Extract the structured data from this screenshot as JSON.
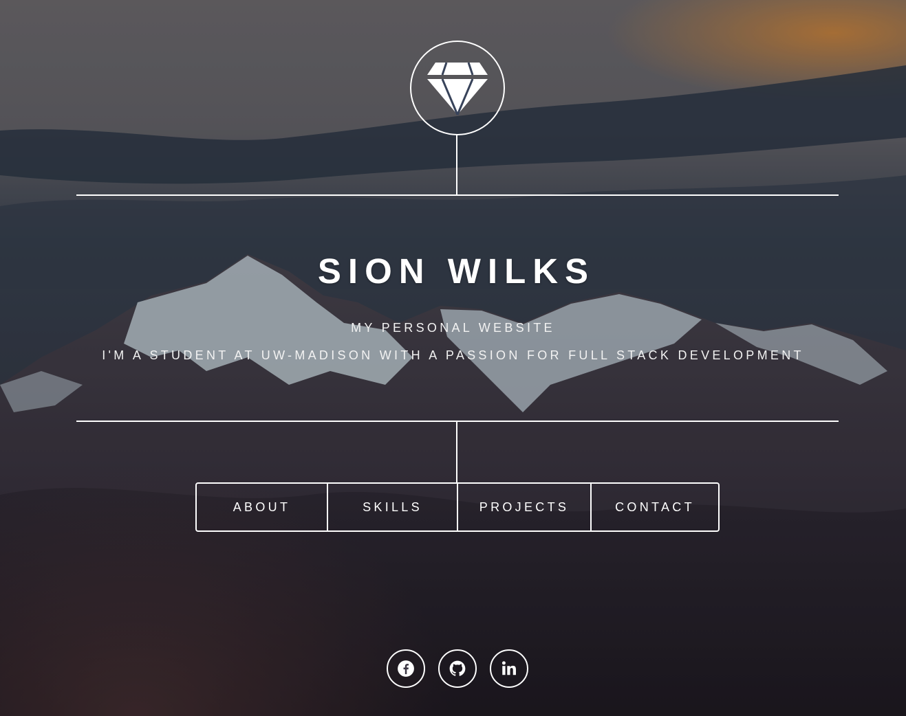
{
  "header": {
    "logo_icon": "diamond-icon"
  },
  "intro": {
    "name": "SION WILKS",
    "tagline": "MY PERSONAL WEBSITE",
    "description": "I'M A STUDENT AT UW-MADISON WITH A PASSION FOR FULL STACK DEVELOPMENT"
  },
  "nav": {
    "items": [
      {
        "label": "ABOUT"
      },
      {
        "label": "SKILLS"
      },
      {
        "label": "PROJECTS"
      },
      {
        "label": "CONTACT"
      }
    ]
  },
  "social": [
    {
      "icon": "facebook-icon"
    },
    {
      "icon": "github-icon"
    },
    {
      "icon": "linkedin-icon"
    }
  ],
  "colors": {
    "foreground": "#ffffff",
    "sky": "#6f6c70",
    "night": "#231f29"
  }
}
